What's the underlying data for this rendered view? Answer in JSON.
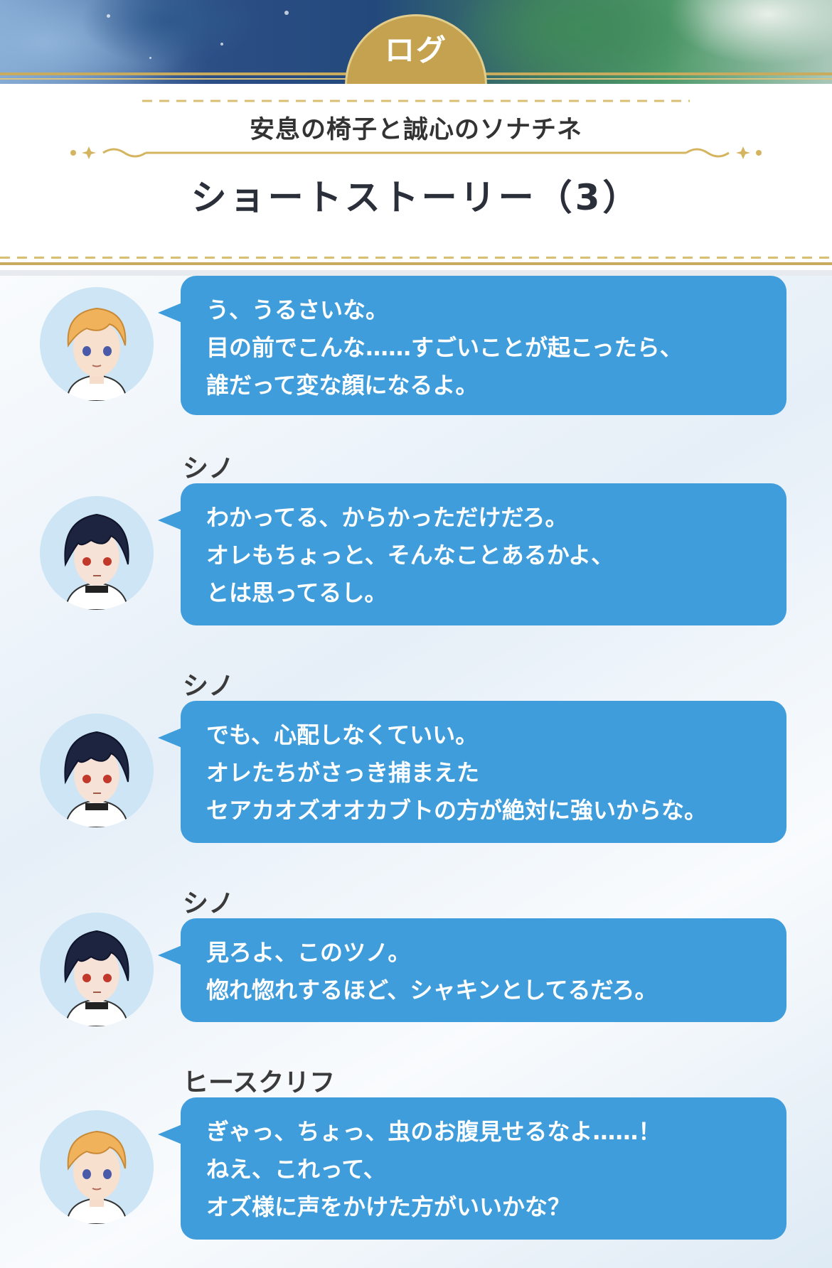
{
  "header": {
    "tab_label": "ログ",
    "subtitle": "安息の椅子と誠心のソナチネ",
    "title": "ショートストーリー（3）"
  },
  "colors": {
    "bubble": "#3f9ddb",
    "gold": "#c4a24f",
    "text_dark": "#2a2f3a"
  },
  "messages": [
    {
      "speaker": "",
      "avatar": "blonde-boy-avatar",
      "lines": [
        "う、うるさいな。",
        "目の前でこんな……すごいことが起こったら、",
        "誰だって変な顔になるよ。"
      ]
    },
    {
      "speaker": "シノ",
      "avatar": "dark-hair-boy-avatar",
      "lines": [
        "わかってる、からかっただけだろ。",
        "オレもちょっと、そんなことあるかよ、",
        "とは思ってるし。"
      ]
    },
    {
      "speaker": "シノ",
      "avatar": "dark-hair-boy-avatar",
      "lines": [
        "でも、心配しなくていい。",
        "オレたちがさっき捕まえた",
        "セアカオズオオカブトの方が絶対に強いからな。"
      ]
    },
    {
      "speaker": "シノ",
      "avatar": "dark-hair-boy-avatar",
      "lines": [
        "見ろよ、このツノ。",
        "惚れ惚れするほど、シャキンとしてるだろ。"
      ]
    },
    {
      "speaker": "ヒースクリフ",
      "avatar": "blonde-boy-avatar",
      "lines": [
        "ぎゃっ、ちょっ、虫のお腹見せるなよ……！",
        "ねえ、これって、",
        "オズ様に声をかけた方がいいかな？"
      ]
    }
  ]
}
